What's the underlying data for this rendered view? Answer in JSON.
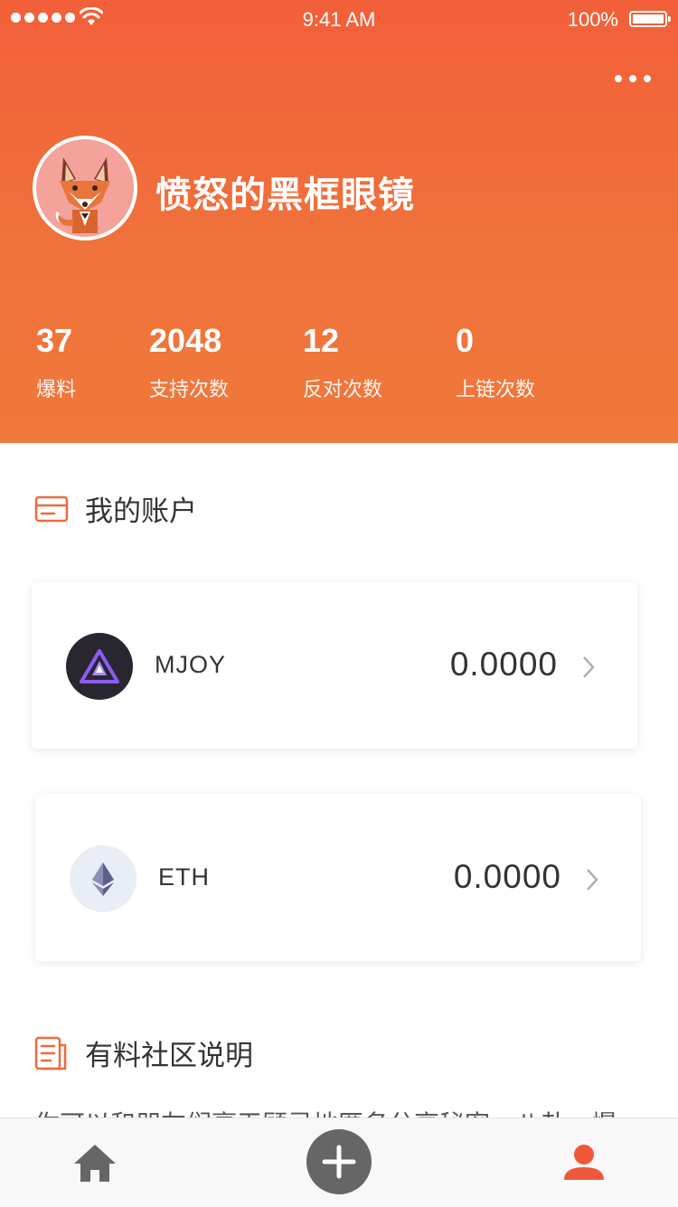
{
  "status_bar": {
    "time": "9:41 AM",
    "battery": "100%"
  },
  "header": {
    "more_icon": "more-horizontal-icon",
    "avatar_icon": "fox-avatar-icon",
    "username": "愤怒的黑框眼镜",
    "stats": [
      {
        "value": "37",
        "label": "爆料"
      },
      {
        "value": "2048",
        "label": "支持次数"
      },
      {
        "value": "12",
        "label": "反对次数"
      },
      {
        "value": "0",
        "label": "上链次数"
      }
    ],
    "colors": {
      "gradient_top": "#f25f3a",
      "gradient_bottom": "#f0783c"
    }
  },
  "account_section": {
    "title": "我的账户",
    "icon": "card-icon"
  },
  "accounts": [
    {
      "name": "MJOY",
      "balance": "0.0000",
      "icon": "mjoy-coin-icon"
    },
    {
      "name": "ETH",
      "balance": "0.0000",
      "icon": "eth-coin-icon"
    }
  ],
  "community_section": {
    "title": "有料社区说明",
    "icon": "document-icon",
    "text": "你可以和朋友们毫无顾忌地匿名分享秘密，八卦，爆"
  },
  "tab_bar": {
    "items": [
      {
        "icon": "home-icon"
      },
      {
        "icon": "plus-icon"
      },
      {
        "icon": "profile-icon"
      }
    ],
    "active_color": "#f0573a",
    "inactive_color": "#666666"
  }
}
